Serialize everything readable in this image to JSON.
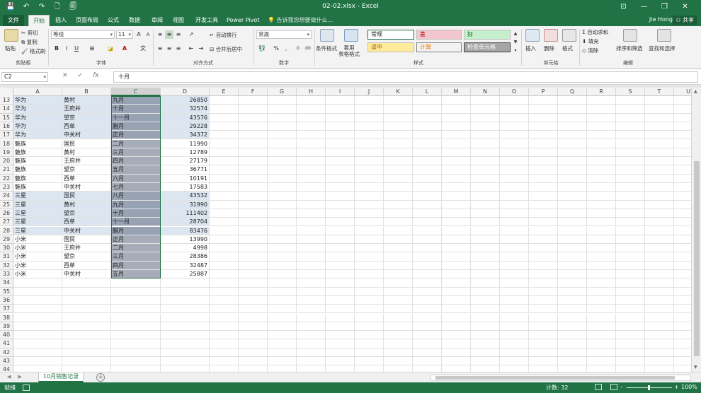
{
  "window": {
    "title": "02-02.xlsx - Excel",
    "minimize": "—",
    "restore": "❐",
    "close": "✕",
    "ribbon_opts": "⊡"
  },
  "qat": {
    "save": "💾",
    "undo": "↶",
    "redo": "↷",
    "new": "🗋",
    "print": "🗐"
  },
  "tabs": {
    "file": "文件",
    "items": [
      "开始",
      "插入",
      "页面布局",
      "公式",
      "数据",
      "审阅",
      "视图",
      "开发工具",
      "Power Pivot"
    ],
    "tell_me": "告诉我您想要做什么...",
    "user": "Jie Hong",
    "share": "共享"
  },
  "ribbon": {
    "clipboard": {
      "label": "剪贴板",
      "paste": "粘贴",
      "cut": "剪切",
      "copy": "复制",
      "format_painter": "格式刷"
    },
    "font": {
      "label": "字体",
      "name": "等线",
      "size": "11",
      "bold": "B",
      "italic": "I",
      "underline": "U"
    },
    "alignment": {
      "label": "对齐方式",
      "wrap": "自动换行",
      "merge": "合并后居中"
    },
    "number": {
      "label": "数字",
      "format": "常规",
      "percent": "%",
      "comma": ","
    },
    "styles": {
      "label": "样式",
      "conditional": "条件格式",
      "table": "套用\n表格格式",
      "normal": "常规",
      "bad": "差",
      "good": "好",
      "neutral": "适中",
      "calc": "计算",
      "check": "检查单元格"
    },
    "cells": {
      "label": "单元格",
      "insert": "插入",
      "delete": "删除",
      "format": "格式"
    },
    "editing": {
      "label": "编辑",
      "autosum": "自动求和",
      "fill": "填充",
      "clear": "清除",
      "sort": "排序和筛选",
      "find": "查找和选择"
    }
  },
  "formula_bar": {
    "name_box": "C2",
    "cancel": "✕",
    "enter": "✓",
    "fx": "fx",
    "value": "十月"
  },
  "columns": [
    "A",
    "B",
    "C",
    "D",
    "E",
    "F",
    "G",
    "H",
    "I",
    "J",
    "K",
    "L",
    "M",
    "N",
    "O",
    "P",
    "Q",
    "R",
    "S",
    "T",
    "U"
  ],
  "rows": [
    {
      "n": "13",
      "a": "华为",
      "b": "黄村",
      "c": "九月",
      "d": "26850",
      "band": true
    },
    {
      "n": "14",
      "a": "华为",
      "b": "王府井",
      "c": "十月",
      "d": "32574",
      "band": true
    },
    {
      "n": "15",
      "a": "华为",
      "b": "望京",
      "c": "十一月",
      "d": "43576",
      "band": true
    },
    {
      "n": "16",
      "a": "华为",
      "b": "西单",
      "c": "腊月",
      "d": "29228",
      "band": true
    },
    {
      "n": "17",
      "a": "华为",
      "b": "中关村",
      "c": "正月",
      "d": "34372",
      "band": true
    },
    {
      "n": "18",
      "a": "魅族",
      "b": "国贸",
      "c": "二月",
      "d": "11990",
      "band": false
    },
    {
      "n": "19",
      "a": "魅族",
      "b": "黄村",
      "c": "三月",
      "d": "12789",
      "band": false
    },
    {
      "n": "20",
      "a": "魅族",
      "b": "王府井",
      "c": "四月",
      "d": "27179",
      "band": false
    },
    {
      "n": "21",
      "a": "魅族",
      "b": "望京",
      "c": "五月",
      "d": "36771",
      "band": false
    },
    {
      "n": "22",
      "a": "魅族",
      "b": "西单",
      "c": "六月",
      "d": "10191",
      "band": false
    },
    {
      "n": "23",
      "a": "魅族",
      "b": "中关村",
      "c": "七月",
      "d": "17583",
      "band": false
    },
    {
      "n": "24",
      "a": "三星",
      "b": "国贸",
      "c": "八月",
      "d": "43532",
      "band": true
    },
    {
      "n": "25",
      "a": "三星",
      "b": "黄村",
      "c": "九月",
      "d": "31990",
      "band": true
    },
    {
      "n": "26",
      "a": "三星",
      "b": "望京",
      "c": "十月",
      "d": "111402",
      "band": true
    },
    {
      "n": "27",
      "a": "三星",
      "b": "西单",
      "c": "十一月",
      "d": "28704",
      "band": true
    },
    {
      "n": "28",
      "a": "三星",
      "b": "中关村",
      "c": "腊月",
      "d": "83476",
      "band": true
    },
    {
      "n": "29",
      "a": "小米",
      "b": "国贸",
      "c": "正月",
      "d": "13990",
      "band": false
    },
    {
      "n": "30",
      "a": "小米",
      "b": "王府井",
      "c": "二月",
      "d": "4998",
      "band": false
    },
    {
      "n": "31",
      "a": "小米",
      "b": "望京",
      "c": "三月",
      "d": "28386",
      "band": false
    },
    {
      "n": "32",
      "a": "小米",
      "b": "西单",
      "c": "四月",
      "d": "32487",
      "band": false
    },
    {
      "n": "33",
      "a": "小米",
      "b": "中关村",
      "c": "五月",
      "d": "25887",
      "band": false
    },
    {
      "n": "34",
      "a": "",
      "b": "",
      "c": "",
      "d": "",
      "band": false
    },
    {
      "n": "35",
      "a": "",
      "b": "",
      "c": "",
      "d": "",
      "band": false
    },
    {
      "n": "36",
      "a": "",
      "b": "",
      "c": "",
      "d": "",
      "band": false
    },
    {
      "n": "37",
      "a": "",
      "b": "",
      "c": "",
      "d": "",
      "band": false
    },
    {
      "n": "38",
      "a": "",
      "b": "",
      "c": "",
      "d": "",
      "band": false
    },
    {
      "n": "39",
      "a": "",
      "b": "",
      "c": "",
      "d": "",
      "band": false
    },
    {
      "n": "40",
      "a": "",
      "b": "",
      "c": "",
      "d": "",
      "band": false
    },
    {
      "n": "41",
      "a": "",
      "b": "",
      "c": "",
      "d": "",
      "band": false
    },
    {
      "n": "42",
      "a": "",
      "b": "",
      "c": "",
      "d": "",
      "band": false
    },
    {
      "n": "43",
      "a": "",
      "b": "",
      "c": "",
      "d": "",
      "band": false
    },
    {
      "n": "44",
      "a": "",
      "b": "",
      "c": "",
      "d": "",
      "band": false
    }
  ],
  "sheet_tabs": {
    "active": "10月销售记录",
    "add": "+"
  },
  "status": {
    "ready": "就绪",
    "count": "计数: 32",
    "zoom": "100%",
    "zoom_out": "-",
    "zoom_in": "+"
  },
  "colors": {
    "accent": "#217346",
    "band": "#dce6f1",
    "selection": "#a6adb8"
  }
}
